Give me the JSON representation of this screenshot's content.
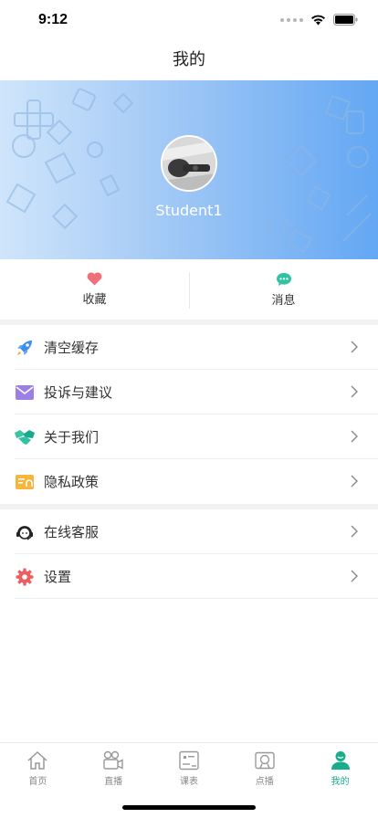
{
  "status_bar": {
    "time": "9:12"
  },
  "nav": {
    "title": "我的"
  },
  "profile": {
    "username": "Student1"
  },
  "quick_actions": [
    {
      "label": "收藏",
      "icon": "heart-icon",
      "color": "#f0707a"
    },
    {
      "label": "消息",
      "icon": "chat-bubble-icon",
      "color": "#2ec3a3"
    }
  ],
  "menu_group_1": [
    {
      "label": "清空缓存",
      "icon": "rocket-icon"
    },
    {
      "label": "投诉与建议",
      "icon": "envelope-icon"
    },
    {
      "label": "关于我们",
      "icon": "handshake-icon"
    },
    {
      "label": "隐私政策",
      "icon": "document-icon"
    }
  ],
  "menu_group_2": [
    {
      "label": "在线客服",
      "icon": "headset-icon"
    },
    {
      "label": "设置",
      "icon": "gear-icon"
    }
  ],
  "tabs": [
    {
      "label": "首页",
      "icon": "home-icon",
      "active": false
    },
    {
      "label": "直播",
      "icon": "video-camera-icon",
      "active": false
    },
    {
      "label": "课表",
      "icon": "schedule-icon",
      "active": false
    },
    {
      "label": "点播",
      "icon": "on-demand-icon",
      "active": false
    },
    {
      "label": "我的",
      "icon": "user-icon",
      "active": true
    }
  ],
  "colors": {
    "accent": "#1aad8c",
    "banner_start": "#cfe5fb",
    "banner_end": "#63a7f3"
  }
}
